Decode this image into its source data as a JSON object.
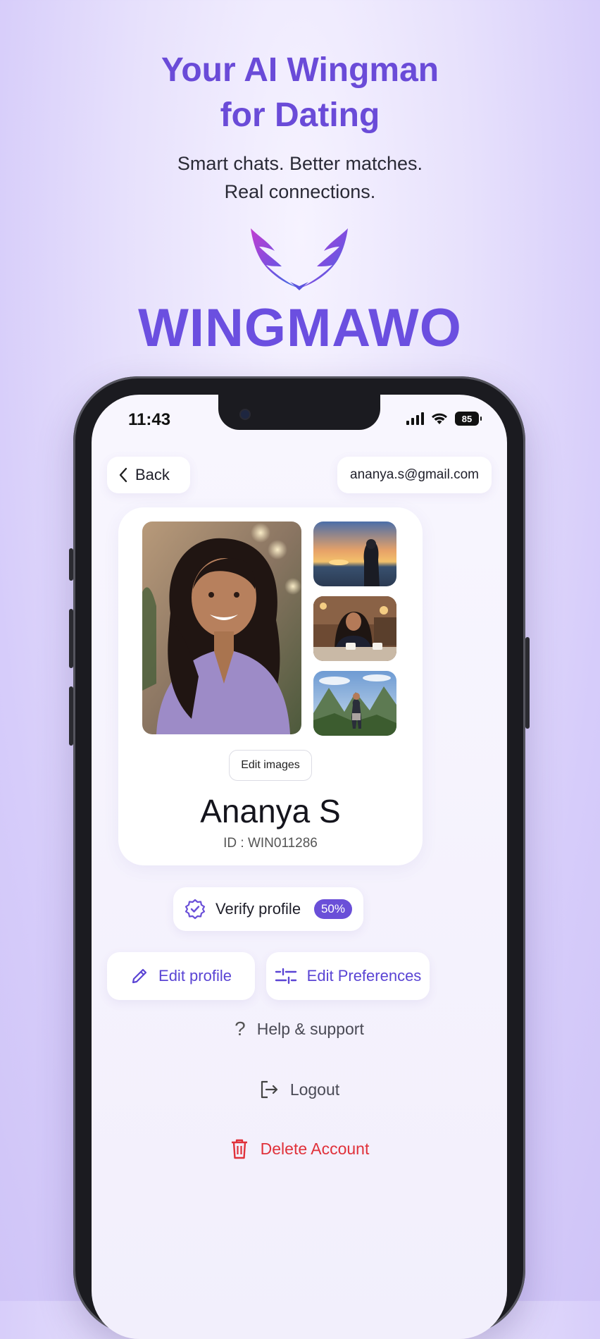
{
  "promo": {
    "title_line1": "Your AI Wingman",
    "title_line2": "for Dating",
    "subtitle_line1": "Smart chats. Better matches.",
    "subtitle_line2": "Real connections.",
    "brand": "WINGMAWO"
  },
  "status_bar": {
    "time": "11:43",
    "battery": "85"
  },
  "header": {
    "back_label": "Back",
    "email": "ananya.s@gmail.com"
  },
  "profile": {
    "edit_images_label": "Edit images",
    "name": "Ananya S",
    "id_text": "ID : WIN011286"
  },
  "verify": {
    "label": "Verify profile",
    "progress_text": "50%",
    "progress": 0.5
  },
  "actions": {
    "edit_profile": "Edit profile",
    "edit_preferences": "Edit Preferences"
  },
  "menu": {
    "help": "Help & support",
    "logout": "Logout",
    "delete": "Delete Account"
  },
  "colors": {
    "accent": "#6a4fd8",
    "danger": "#e0313a"
  }
}
